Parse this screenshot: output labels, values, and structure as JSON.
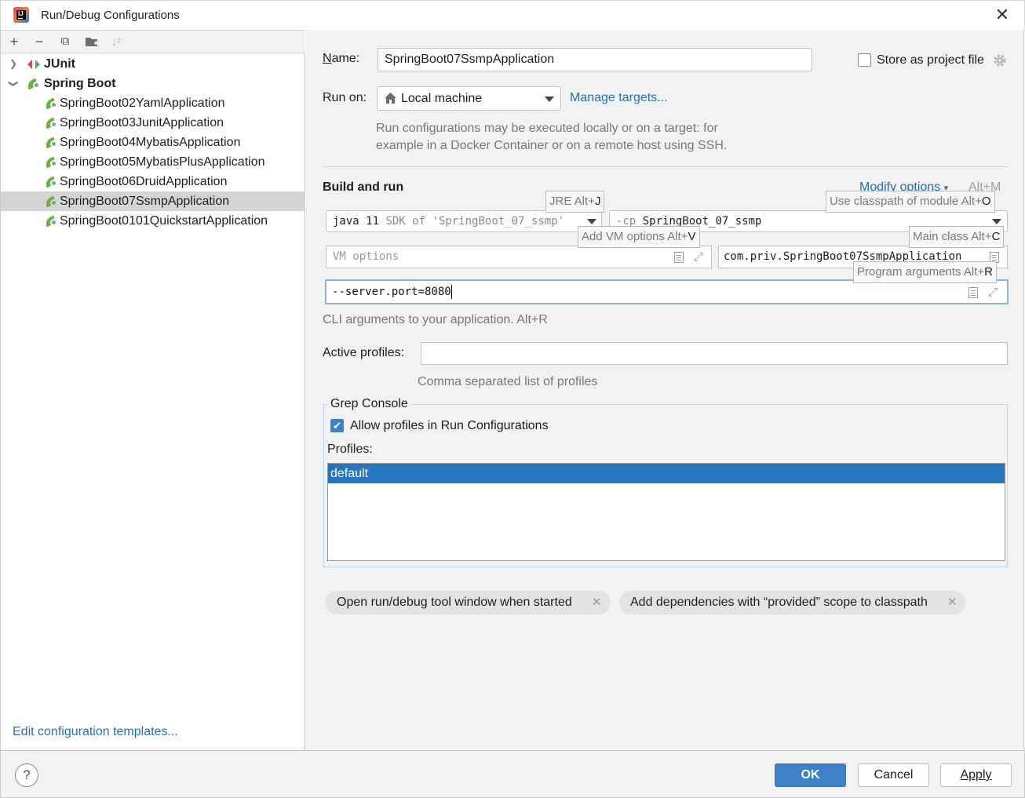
{
  "window": {
    "title": "Run/Debug Configurations",
    "close_icon": "close-icon",
    "app_icon": "intellij-idea-icon"
  },
  "toolbar": {
    "add": "+",
    "remove": "−",
    "copy": "⧉",
    "folder": "folder-add-icon",
    "sort": "sort-icon"
  },
  "tree": {
    "groups": [
      {
        "label": "JUnit",
        "expanded": false
      },
      {
        "label": "Spring Boot",
        "expanded": true
      }
    ],
    "items": [
      "SpringBoot02YamlApplication",
      "SpringBoot03JunitApplication",
      "SpringBoot04MybatisApplication",
      "SpringBoot05MybatisPlusApplication",
      "SpringBoot06DruidApplication",
      "SpringBoot07SsmpApplication",
      "SpringBoot0101QuickstartApplication"
    ],
    "selected": "SpringBoot07SsmpApplication"
  },
  "edit_templates": "Edit configuration templates...",
  "form": {
    "name_label": "Name:",
    "name_value": "SpringBoot07SsmpApplication",
    "store_label": "Store as project file",
    "store_checked": false,
    "run_on_label": "Run on:",
    "run_on_value": "Local machine",
    "manage_targets": "Manage targets...",
    "run_on_hint_1": "Run configurations may be executed locally or on a target: for",
    "run_on_hint_2": "example in a Docker Container or on a remote host using SSH.",
    "build_run": "Build and run",
    "modify_options": "Modify options",
    "modify_shortcut": "Alt+M",
    "jre_main": "java 11",
    "jre_sdk": "SDK of 'SpringBoot_07_ssmp'",
    "cp_flag": "-cp",
    "cp_module": "SpringBoot_07_ssmp",
    "vm_placeholder": "VM options",
    "main_class": "com.priv.SpringBoot07SsmpApplication",
    "program_args": "--server.port=8080",
    "cli_hint": "CLI arguments to your application. Alt+R",
    "active_profiles_label": "Active profiles:",
    "active_profiles_value": "",
    "profiles_hint": "Comma separated list of profiles"
  },
  "tooltips": {
    "jre": {
      "text": "JRE Alt+",
      "key": "J"
    },
    "classpath": {
      "text": "Use classpath of module Alt+",
      "key": "O"
    },
    "vm": {
      "text": "Add VM options Alt+",
      "key": "V"
    },
    "main": {
      "text": "Main class Alt+",
      "key": "C"
    },
    "args": {
      "text": "Program arguments Alt+",
      "key": "R"
    }
  },
  "grep": {
    "title": "Grep Console",
    "allow_label": "Allow profiles in Run Configurations",
    "allow_checked": true,
    "profiles_label": "Profiles:",
    "profiles": [
      "default"
    ]
  },
  "chips": [
    "Open run/debug tool window when started",
    "Add dependencies with “provided” scope to classpath"
  ],
  "buttons": {
    "help": "?",
    "ok": "OK",
    "cancel": "Cancel",
    "apply": "Apply"
  },
  "colors": {
    "accent": "#3d82c9",
    "link": "#2470b3",
    "selection": "#2675bf"
  }
}
